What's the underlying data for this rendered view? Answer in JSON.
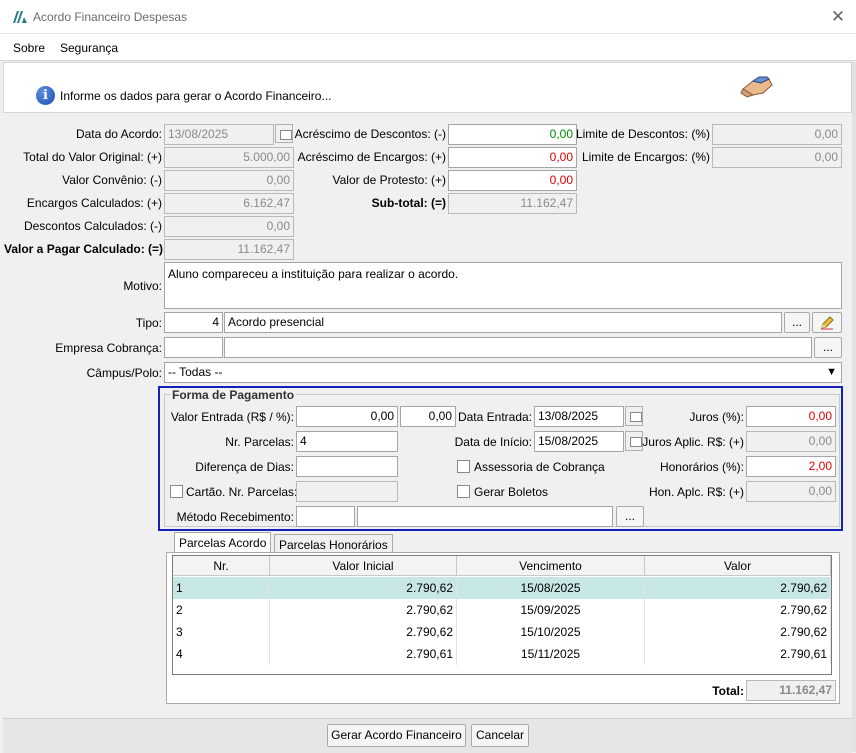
{
  "window": {
    "title": "Acordo Financeiro Despesas"
  },
  "menu": [
    {
      "label": "Sobre"
    },
    {
      "label": "Segurança"
    }
  ],
  "header": {
    "text": "Informe os dados para gerar o Acordo Financeiro..."
  },
  "left": {
    "data_acordo_label": "Data do Acordo:",
    "data_acordo": "13/08/2025",
    "total_original_label": "Total do Valor Original: (+)",
    "total_original": "5.000,00",
    "valor_convenio_label": "Valor Convênio: (-)",
    "valor_convenio": "0,00",
    "encargos_label": "Encargos Calculados: (+)",
    "encargos": "6.162,47",
    "descontos_label": "Descontos Calculados: (-)",
    "descontos": "0,00",
    "valor_pagar_label": "Valor a Pagar Calculado: (=)",
    "valor_pagar": "11.162,47"
  },
  "middle": {
    "acresc_descontos_label": "Acréscimo de Descontos: (-)",
    "acresc_descontos": "0,00",
    "acresc_encargos_label": "Acréscimo de Encargos: (+)",
    "acresc_encargos": "0,00",
    "protesto_label": "Valor de Protesto: (+)",
    "protesto": "0,00",
    "subtotal_label": "Sub-total: (=)",
    "subtotal": "11.162,47"
  },
  "right": {
    "limite_descontos_label": "Limite de Descontos: (%)",
    "limite_descontos": "0,00",
    "limite_encargos_label": "Limite de Encargos: (%)",
    "limite_encargos": "0,00"
  },
  "motivo": {
    "label": "Motivo:",
    "value": "Aluno compareceu a instituição para realizar o acordo."
  },
  "tipo": {
    "label": "Tipo:",
    "code": "4",
    "desc": "Acordo presencial",
    "browse": "..."
  },
  "empresa": {
    "label": "Empresa Cobrança:",
    "code": "",
    "desc": "",
    "browse": "..."
  },
  "campus": {
    "label": "Câmpus/Polo:",
    "value": "-- Todas --"
  },
  "pagamento": {
    "legend": "Forma de Pagamento",
    "valor_entrada_label": "Valor Entrada (R$ / %):",
    "valor_entrada": "0,00",
    "valor_entrada_pct": "0,00",
    "data_entrada_label": "Data Entrada:",
    "data_entrada": "13/08/2025",
    "juros_label": "Juros (%):",
    "juros": "0,00",
    "nr_parcelas_label": "Nr. Parcelas:",
    "nr_parcelas": "4",
    "data_inicio_label": "Data de Início:",
    "data_inicio": "15/08/2025",
    "juros_aplic_label": "Juros Aplic. R$: (+)",
    "juros_aplic": "0,00",
    "diferenca_label": "Diferença de Dias:",
    "diferenca": "",
    "assessoria_label": "Assessoria de Cobrança",
    "honorarios_label": "Honorários (%):",
    "honorarios": "2,00",
    "cartao_label": "Cartão. Nr. Parcelas:",
    "cartao": "",
    "gerar_boletos_label": "Gerar Boletos",
    "hon_aplic_label": "Hon. Aplc. R$: (+)",
    "hon_aplic": "0,00",
    "metodo_label": "Método Recebimento:",
    "metodo_code": "",
    "metodo_desc": "",
    "browse": "..."
  },
  "tabs": [
    {
      "label": "Parcelas Acordo"
    },
    {
      "label": "Parcelas Honorários"
    }
  ],
  "grid": {
    "columns": [
      "Nr.",
      "Valor Inicial",
      "Vencimento",
      "Valor"
    ],
    "rows": [
      {
        "nr": "1",
        "valor_inicial": "2.790,62",
        "vencimento": "15/08/2025",
        "valor": "2.790,62"
      },
      {
        "nr": "2",
        "valor_inicial": "2.790,62",
        "vencimento": "15/09/2025",
        "valor": "2.790,62"
      },
      {
        "nr": "3",
        "valor_inicial": "2.790,62",
        "vencimento": "15/10/2025",
        "valor": "2.790,62"
      },
      {
        "nr": "4",
        "valor_inicial": "2.790,61",
        "vencimento": "15/11/2025",
        "valor": "2.790,61"
      }
    ],
    "total_label": "Total:",
    "total": "11.162,47"
  },
  "buttons": {
    "gerar": "Gerar Acordo Financeiro",
    "cancelar": "Cancelar"
  }
}
